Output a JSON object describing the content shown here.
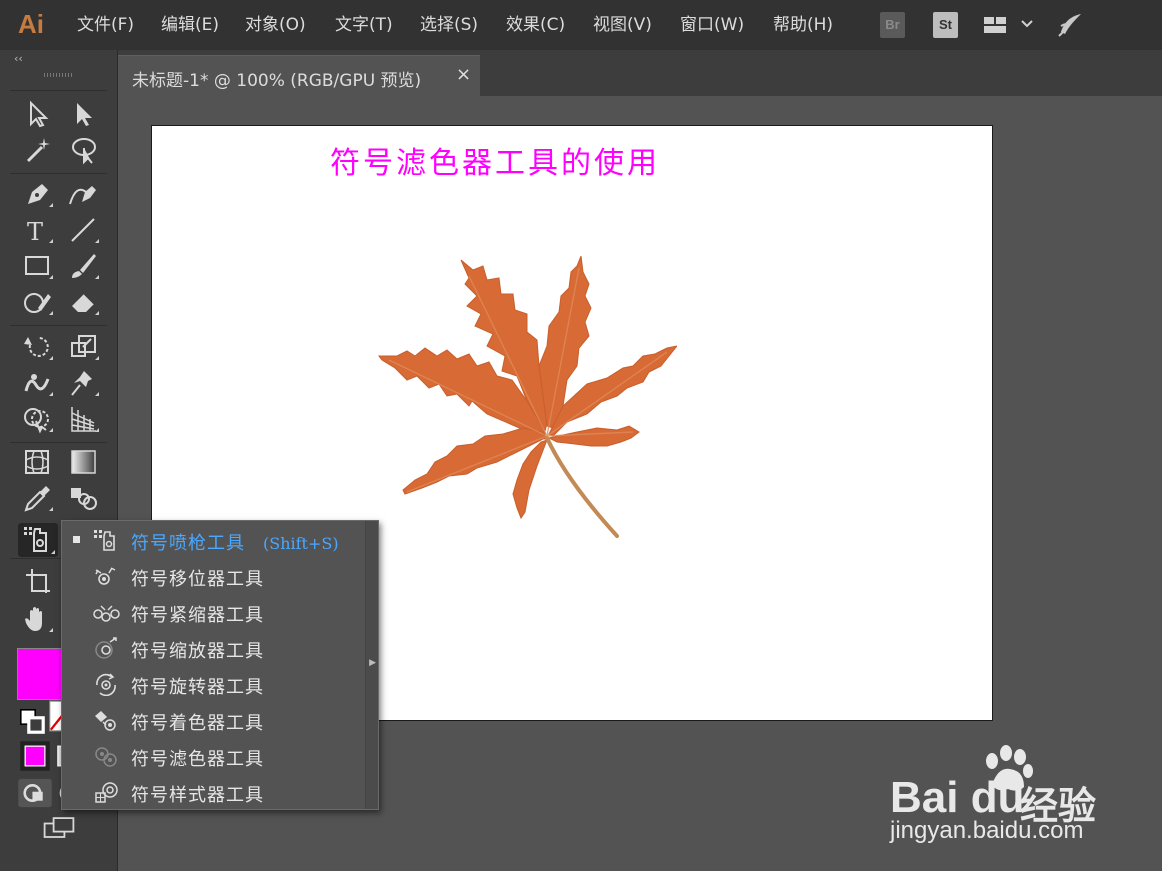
{
  "menubar": {
    "logo": "Ai",
    "items": [
      "文件(F)",
      "编辑(E)",
      "对象(O)",
      "文字(T)",
      "选择(S)",
      "效果(C)",
      "视图(V)",
      "窗口(W)",
      "帮助(H)"
    ],
    "br_label": "Br",
    "st_label": "St"
  },
  "document": {
    "tab_title": "未标题-1* @ 100% (RGB/GPU 预览)",
    "close_glyph": "×"
  },
  "toolbar": {
    "collapse_glyph": "‹‹",
    "fill_color": "#ff00ff"
  },
  "canvas": {
    "title_text": "符号滤色器工具的使用",
    "title_color": "#ff00ff",
    "leaf_color": "#d76a35"
  },
  "flyout": {
    "items": [
      {
        "label": "符号喷枪工具",
        "shortcut": "(Shift+S)",
        "icon": "symbol-sprayer-icon"
      },
      {
        "label": "符号移位器工具",
        "icon": "symbol-shifter-icon"
      },
      {
        "label": "符号紧缩器工具",
        "icon": "symbol-scruncher-icon"
      },
      {
        "label": "符号缩放器工具",
        "icon": "symbol-sizer-icon"
      },
      {
        "label": "符号旋转器工具",
        "icon": "symbol-spinner-icon"
      },
      {
        "label": "符号着色器工具",
        "icon": "symbol-stainer-icon"
      },
      {
        "label": "符号滤色器工具",
        "icon": "symbol-screener-icon"
      },
      {
        "label": "符号样式器工具",
        "icon": "symbol-styler-icon"
      }
    ]
  },
  "watermark": {
    "brand": "Bai  du",
    "cn": "经验",
    "url": "jingyan.baidu.com"
  }
}
